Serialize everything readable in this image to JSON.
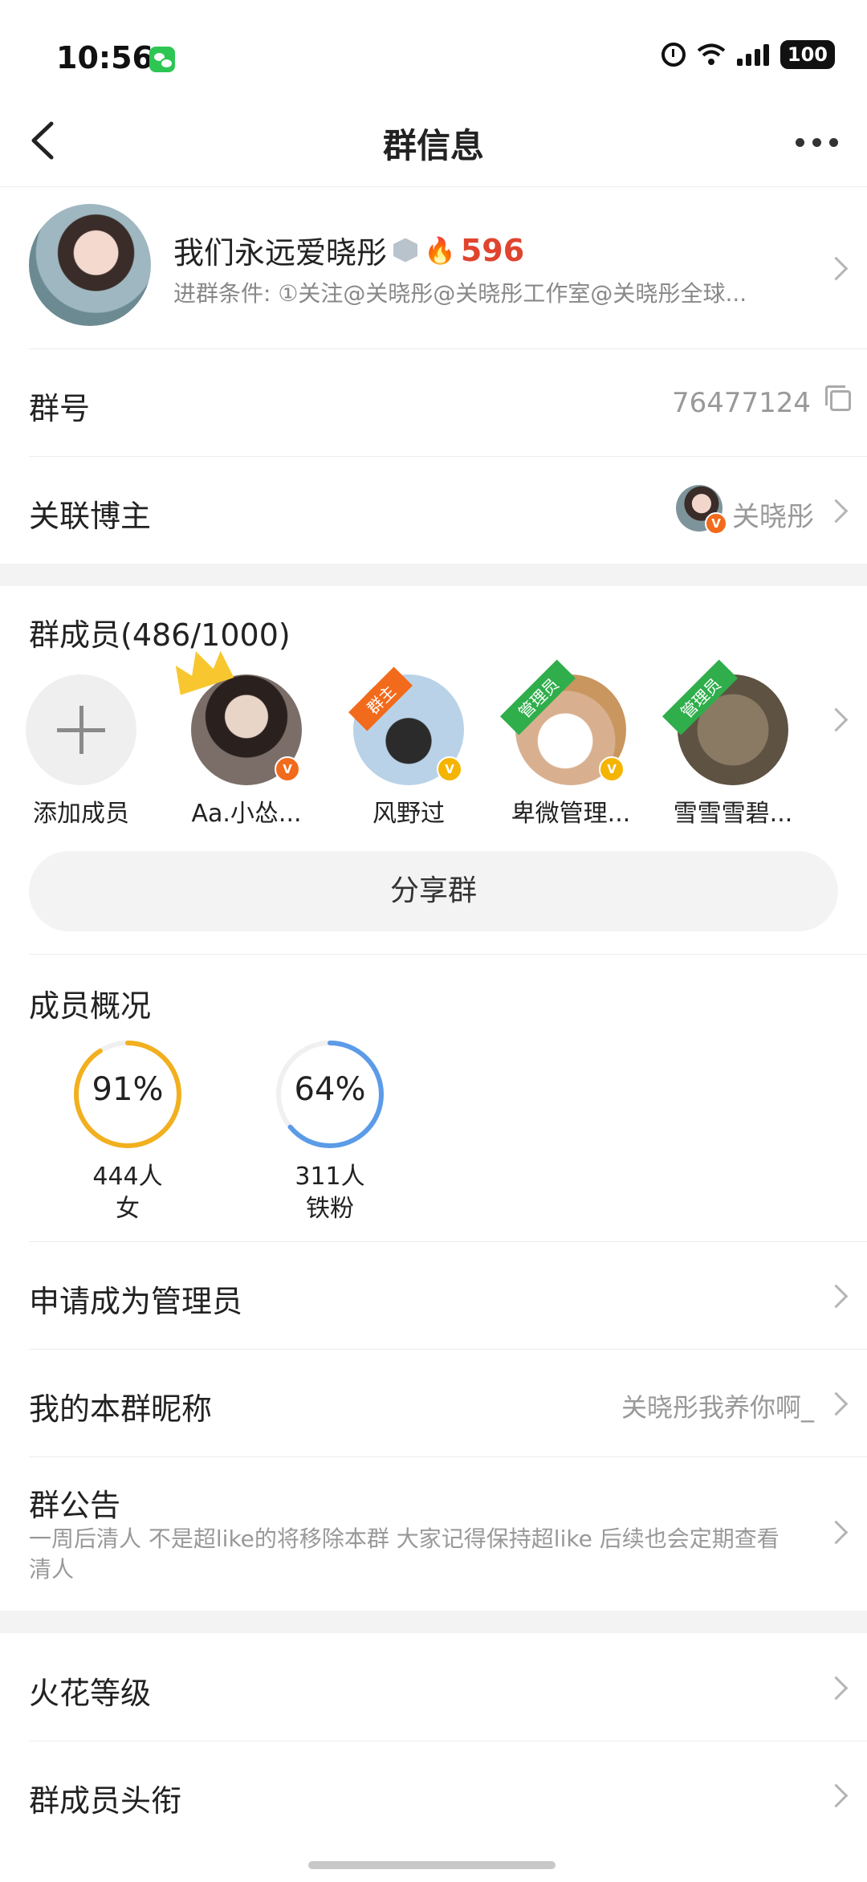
{
  "status_bar": {
    "time": "10:56",
    "battery": "100"
  },
  "nav": {
    "title": "群信息"
  },
  "group": {
    "name": "我们永远爱晓彤",
    "fire_count": "596",
    "conditions": "进群条件: ①关注@关晓彤@关晓彤工作室@关晓彤全球..."
  },
  "group_number": {
    "label": "群号",
    "value": "76477124"
  },
  "linked_blogger": {
    "label": "关联博主",
    "value": "关晓彤"
  },
  "members": {
    "title": "群成员(486/1000)",
    "add_label": "添加成员",
    "list": [
      {
        "name": "Aa.小怂...",
        "badge": "V"
      },
      {
        "name": "风野过",
        "role": "群主",
        "badge": "V"
      },
      {
        "name": "卑微管理...",
        "role": "管理员",
        "badge": "V"
      },
      {
        "name": "雪雪雪碧...",
        "role": "管理员"
      }
    ]
  },
  "share_button": "分享群",
  "overview": {
    "title": "成员概况",
    "stats": [
      {
        "percent": "91%",
        "count": "444人",
        "label": "女",
        "value": 0.91,
        "color": "#f2b01e"
      },
      {
        "percent": "64%",
        "count": "311人",
        "label": "铁粉",
        "value": 0.64,
        "color": "#5b9be8"
      }
    ]
  },
  "rows": {
    "apply_admin": "申请成为管理员",
    "nickname_label": "我的本群昵称",
    "nickname_value": "关晓彤我养你啊_",
    "notice_label": "群公告",
    "notice_text": "一周后清人 不是超like的将移除本群 大家记得保持超like 后续也会定期查看清人",
    "spark_level": "火花等级",
    "member_titles": "群成员头衔"
  }
}
